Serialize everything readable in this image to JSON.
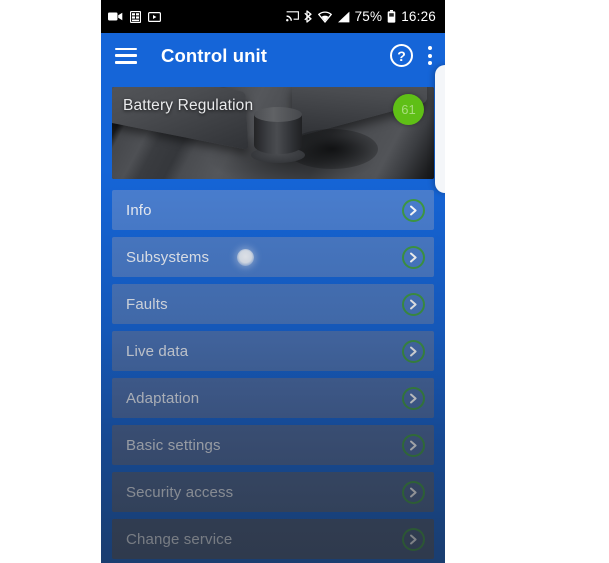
{
  "status_bar": {
    "left_icons": [
      "camcorder-icon",
      "grid-icon",
      "video-player-icon"
    ],
    "right_icons": [
      "cast-icon",
      "bluetooth-icon",
      "wifi-icon",
      "signal-icon"
    ],
    "battery_percent": "75%",
    "battery_icon": "battery-icon",
    "clock": "16:26"
  },
  "app_bar": {
    "menu_icon": "hamburger-icon",
    "title": "Control unit",
    "help_icon": "help-icon",
    "help_glyph": "?",
    "overflow_icon": "overflow-menu-icon"
  },
  "hero": {
    "title": "Battery Regulation",
    "badge": "61",
    "badge_color": "#5fbf16",
    "image_name": "control-unit-photo"
  },
  "menu": {
    "chevron_color": "#3f9b43",
    "items": [
      {
        "label": "Info",
        "has_spinner": false
      },
      {
        "label": "Subsystems",
        "has_spinner": true
      },
      {
        "label": "Faults",
        "has_spinner": false
      },
      {
        "label": "Live data",
        "has_spinner": false
      },
      {
        "label": "Adaptation",
        "has_spinner": false
      },
      {
        "label": "Basic settings",
        "has_spinner": false
      },
      {
        "label": "Security access",
        "has_spinner": false
      },
      {
        "label": "Change service",
        "has_spinner": false
      }
    ]
  },
  "theme": {
    "primary": "#1565d8",
    "status_bar_bg": "#000000",
    "row_text": "#edf1f8"
  }
}
